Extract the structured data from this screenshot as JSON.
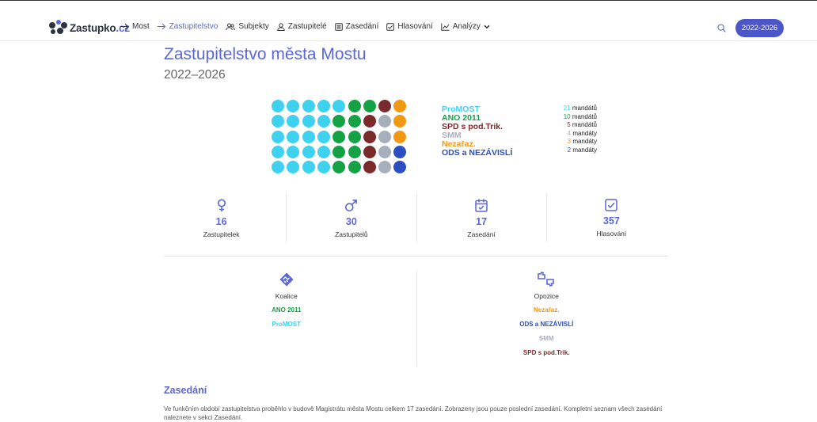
{
  "brand": {
    "name": "Zastupko",
    "tld": ".cz"
  },
  "nav": {
    "items": [
      {
        "label": "Most",
        "icon": "arrow-right-icon"
      },
      {
        "label": "Zastupitelstvo",
        "icon": "arrow-right-icon",
        "active": true
      },
      {
        "label": "Subjekty",
        "icon": "users-icon"
      },
      {
        "label": "Zastupitelé",
        "icon": "user-icon"
      },
      {
        "label": "Zasedání",
        "icon": "document-icon"
      },
      {
        "label": "Hlasování",
        "icon": "checkbox-icon"
      },
      {
        "label": "Analýzy",
        "icon": "chart-icon"
      }
    ],
    "search_icon": "search-icon",
    "term_button": "2022-2026"
  },
  "page": {
    "title": "Zastupitelstvo města Mostu",
    "subtitle": "2022–2026"
  },
  "parties": [
    {
      "name": "ProMOST",
      "seats": 21,
      "mandates": "mandátů",
      "color": "#3ed1f0"
    },
    {
      "name": "ANO 2011",
      "seats": 10,
      "mandates": "mandátů",
      "color": "#15a245"
    },
    {
      "name": "SPD s pod.Trik.",
      "seats": 5,
      "mandates": "mandátů",
      "color": "#7a2a2a"
    },
    {
      "name": "SMM",
      "seats": 4,
      "mandates": "mandáty",
      "color": "#a7afbd"
    },
    {
      "name": "Nezařaz.",
      "seats": 3,
      "mandates": "mandáty",
      "color": "#f29712"
    },
    {
      "name": "ODS a NEZÁVISLÍ",
      "seats": 2,
      "mandates": "mandáty",
      "color": "#2b4ec2"
    }
  ],
  "stats": [
    {
      "icon": "female-icon",
      "value": "16",
      "label": "Zastupitelek"
    },
    {
      "icon": "male-icon",
      "value": "30",
      "label": "Zastupitelů"
    },
    {
      "icon": "calendar-icon",
      "value": "17",
      "label": "Zasedání"
    },
    {
      "icon": "checkbox-icon",
      "value": "357",
      "label": "Hlasování"
    }
  ],
  "coalition": {
    "icon": "handshake-icon",
    "title": "Koalice",
    "parties": [
      {
        "name": "ANO 2011",
        "color": "#15a245"
      },
      {
        "name": "ProMOST",
        "color": "#3ed1f0"
      }
    ]
  },
  "opposition": {
    "icon": "thumbs-icon",
    "title": "Opozice",
    "parties": [
      {
        "name": "Nezařaz.",
        "color": "#f29712"
      },
      {
        "name": "ODS a NEZÁVISLÍ",
        "color": "#2b4ec2"
      },
      {
        "name": "SMM",
        "color": "#a7afbd"
      },
      {
        "name": "SPD s pod.Trik.",
        "color": "#7a2a2a"
      }
    ]
  },
  "sessions": {
    "title": "Zasedání",
    "text": "Ve funkčním období zastupitelstva proběhlo v budově Magistrátu města Mostu celkem 17 zasedání. Zobrazeny jsou pouze poslední zasedání. Kompletní seznam všech zasedání naleznete v sekci Zasedání."
  }
}
